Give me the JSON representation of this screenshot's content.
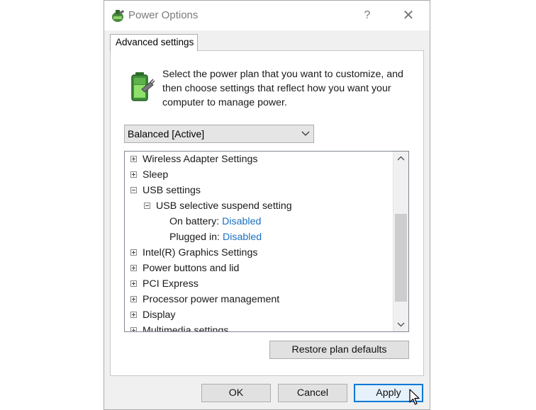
{
  "window": {
    "title": "Power Options",
    "help_label": "?",
    "close_label": "✕",
    "icon": "power-options-icon"
  },
  "tab": {
    "label": "Advanced settings"
  },
  "intro": {
    "icon": "battery-plug-icon",
    "text": "Select the power plan that you want to customize, and then choose settings that reflect how you want your computer to manage power."
  },
  "plan_select": {
    "value": "Balanced [Active]"
  },
  "tree": {
    "wireless": "Wireless Adapter Settings",
    "sleep": "Sleep",
    "usb": "USB settings",
    "usb_suspend": "USB selective suspend setting",
    "on_battery_label": "On battery:",
    "on_battery_value": "Disabled",
    "plugged_in_label": "Plugged in:",
    "plugged_in_value": "Disabled",
    "intel": "Intel(R) Graphics Settings",
    "power_buttons": "Power buttons and lid",
    "pci": "PCI Express",
    "processor": "Processor power management",
    "display": "Display",
    "multimedia": "Multimedia settings"
  },
  "buttons": {
    "restore": "Restore plan defaults",
    "ok": "OK",
    "cancel": "Cancel",
    "apply": "Apply"
  },
  "colors": {
    "accent": "#0078d7",
    "link_value": "#1a6fc0"
  }
}
